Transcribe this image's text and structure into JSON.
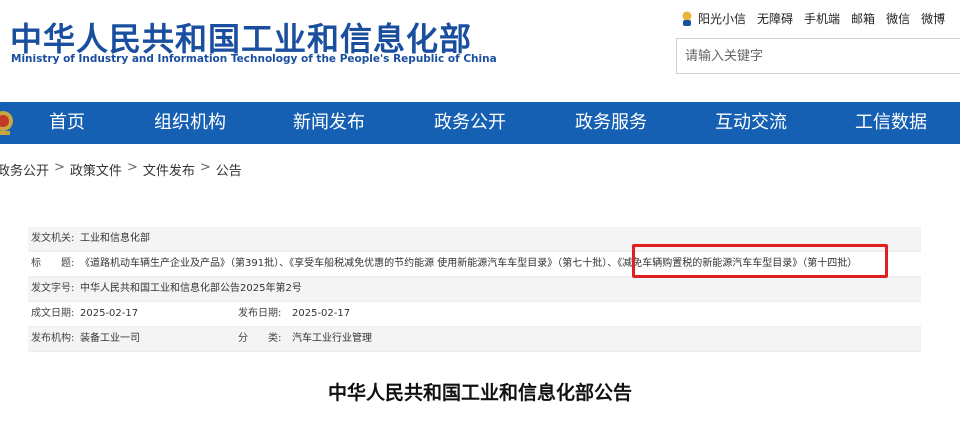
{
  "header": {
    "title": "中华人民共和国工业和信息化部",
    "subtitle": "Ministry of Industry and Information Technology of the People's Republic of China",
    "toplinks": [
      "阳光小信",
      "无障碍",
      "手机端",
      "邮箱",
      "微信",
      "微博"
    ],
    "search_placeholder": "请输入关键字"
  },
  "nav": {
    "items": [
      "首页",
      "组织机构",
      "新闻发布",
      "政务公开",
      "政务服务",
      "互动交流",
      "工信数据"
    ]
  },
  "breadcrumb": [
    "政务公开",
    "政策文件",
    "文件发布",
    "公告"
  ],
  "info": {
    "issuer_label": "发文机关:",
    "issuer": "工业和信息化部",
    "title_label": "标　　题:",
    "title": "《道路机动车辆生产企业及产品》（第391批）、《享受车船税减免优惠的节约能源 使用新能源汽车车型目录》（第七十批）、《减免车辆购置税的新能源汽车车型目录》（第十四批）",
    "doc_no_label": "发文字号:",
    "doc_no": "中华人民共和国工业和信息化部公告2025年第2号",
    "written_date_label": "成文日期:",
    "written_date": "2025-02-17",
    "publish_date_label": "发布日期:",
    "publish_date": "2025-02-17",
    "org_label": "发布机构:",
    "org": "装备工业一司",
    "category_label": "分　　类:",
    "category": "汽车工业行业管理"
  },
  "document_title": "中华人民共和国工业和信息化部公告",
  "colors": {
    "nav_bg": "#1660b3",
    "title_blue": "#1a4fa0",
    "highlight": "#e02020"
  }
}
